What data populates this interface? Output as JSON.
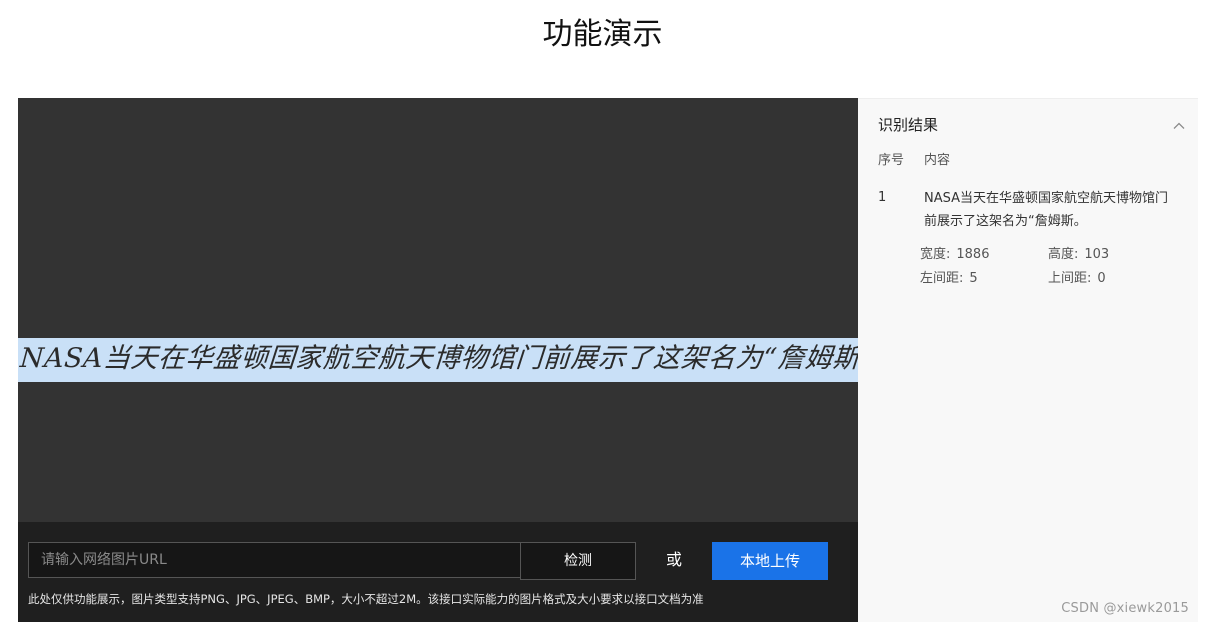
{
  "page": {
    "title": "功能演示"
  },
  "preview": {
    "recognized_image_text": "NASA当天在华盛顿国家航空航天博物馆门前展示了这架名为“詹姆斯·"
  },
  "controls": {
    "url_placeholder": "请输入网络图片URL",
    "url_value": "",
    "detect_label": "检测",
    "or_label": "或",
    "upload_label": "本地上传",
    "notice": "此处仅供功能展示，图片类型支持PNG、JPG、JPEG、BMP，大小不超过2M。该接口实际能力的图片格式及大小要求以接口文档为准"
  },
  "result": {
    "title": "识别结果",
    "collapse_icon": "chevron-up-icon",
    "columns": [
      "序号",
      "内容"
    ],
    "rows": [
      {
        "index": "1",
        "content": "NASA当天在华盛顿国家航空航天博物馆门前展示了这架名为“詹姆斯。",
        "width_label": "宽度:",
        "width_value": "1886",
        "height_label": "高度:",
        "height_value": "103",
        "left_label": "左间距:",
        "left_value": "5",
        "top_label": "上间距:",
        "top_value": "0"
      }
    ]
  },
  "watermark": "CSDN @xiewk2015",
  "colors": {
    "preview_bg": "#333333",
    "highlight": "#c9e0f7",
    "control_bar_bg": "#1f1f1f",
    "upload_button": "#1a73e8",
    "result_bg": "#f8f8f8"
  }
}
